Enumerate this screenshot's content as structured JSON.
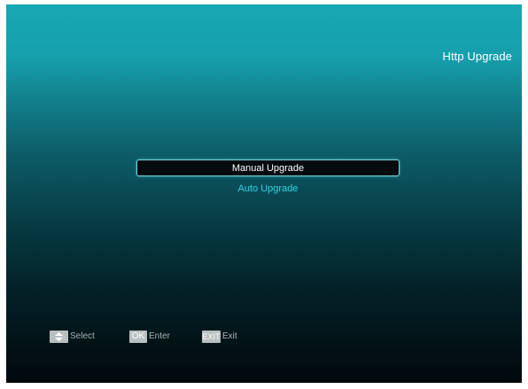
{
  "screen": {
    "title": "Http Upgrade"
  },
  "menu": {
    "items": [
      {
        "label": "Manual Upgrade",
        "selected": true
      },
      {
        "label": "Auto Upgrade",
        "selected": false
      }
    ]
  },
  "footer": {
    "select": {
      "key_icon": "up-down-arrows-icon",
      "label": "Select"
    },
    "enter": {
      "key_label": "OK",
      "label": "Enter"
    },
    "exit": {
      "key_label": "EXIT",
      "label": "Exit"
    }
  },
  "colors": {
    "background_top": "#17a8b4",
    "background_bottom": "#01080b",
    "highlight_border": "#6fd6de",
    "inactive_item_text": "#31d3e4",
    "key_background": "#b8c0c2"
  }
}
